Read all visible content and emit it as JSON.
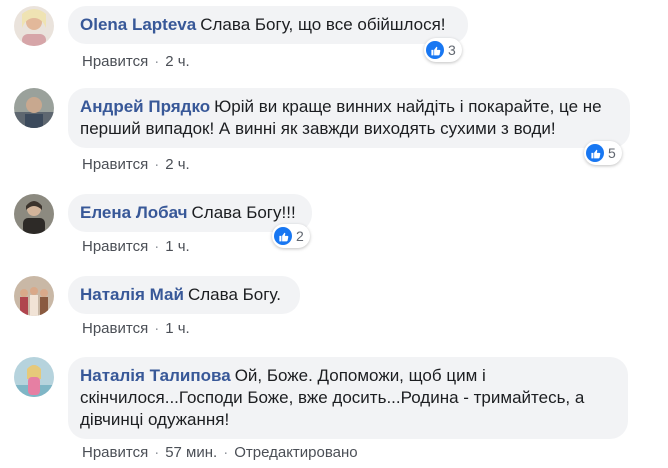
{
  "comments": [
    {
      "author": "Olena Lapteva",
      "text": "Слава Богу, що все обійшлося!",
      "like_label": "Нравится",
      "separator": "·",
      "time": "2 ч.",
      "reactions": "3",
      "avatar_color": "#d9c7b5"
    },
    {
      "author": "Андрей Прядко",
      "text": "Юрій ви краще винних найдіть і покарайте, це не перший випадок! А винні як завжди виходять сухими з води!",
      "like_label": "Нравится",
      "separator": "·",
      "time": "2 ч.",
      "reactions": "5",
      "avatar_color": "#8f8f86"
    },
    {
      "author": "Елена Лобач",
      "text": "Слава Богу!!!",
      "like_label": "Нравится",
      "separator": "·",
      "time": "1 ч.",
      "reactions": "2",
      "avatar_color": "#6d6a60"
    },
    {
      "author": "Наталія Май",
      "text": "Слава Богу.",
      "like_label": "Нравится",
      "separator": "·",
      "time": "1 ч.",
      "reactions": "",
      "avatar_color": "#b79a86"
    },
    {
      "author": "Наталія Талипова",
      "text": "Ой, Боже. Допоможи, щоб цим і скінчилося...Господи Боже, вже досить...Родина - тримайтесь, а дівчинці одужання!",
      "like_label": "Нравится",
      "separator": "·",
      "time": "57 мин.",
      "edited": "Отредактировано",
      "reactions": "",
      "avatar_color": "#a9c3cf"
    }
  ],
  "colors": {
    "author": "#385898",
    "bubble": "#f2f3f5",
    "like": "#1877f2",
    "meta": "#616770"
  },
  "icons": {
    "reaction": "thumbs-up-icon"
  }
}
